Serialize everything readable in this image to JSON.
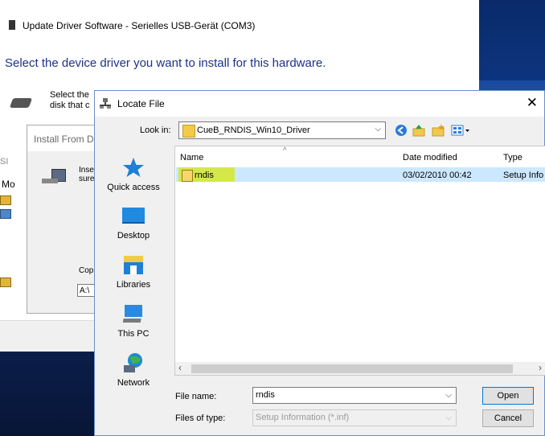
{
  "wizard": {
    "title": "Update Driver Software - Serielles USB-Gerät (COM3)",
    "heading": "Select the device driver you want to install for this hardware.",
    "select_line1": "Select the",
    "select_line2": "disk that c"
  },
  "install_from_disk": {
    "title": "Install From D",
    "ins_line1": "Inse",
    "ins_line2": "sure",
    "copy_label": "Cop",
    "path_value": "A:\\"
  },
  "left_fragments": {
    "si": "SI",
    "mo": "Mo"
  },
  "locate_file": {
    "title": "Locate File",
    "close": "✕",
    "look_in_label": "Look in:",
    "look_in_value": "CueB_RNDIS_Win10_Driver",
    "places": [
      {
        "label": "Quick access"
      },
      {
        "label": "Desktop"
      },
      {
        "label": "Libraries"
      },
      {
        "label": "This PC"
      },
      {
        "label": "Network"
      }
    ],
    "columns": {
      "name": "Name",
      "date": "Date modified",
      "type": "Type"
    },
    "files": [
      {
        "name": "rndis",
        "date": "03/02/2010 00:42",
        "type": "Setup Info"
      }
    ],
    "file_name_label": "File name:",
    "file_name_value": "rndis",
    "files_of_type_label": "Files of type:",
    "files_of_type_value": "Setup Information (*.inf)",
    "open_label": "Open",
    "cancel_label": "Cancel"
  },
  "colors": {
    "heading": "#1e3287",
    "selection": "#cce8ff",
    "highlight": "#d4e84a",
    "desktop": "#0d3a8c"
  }
}
